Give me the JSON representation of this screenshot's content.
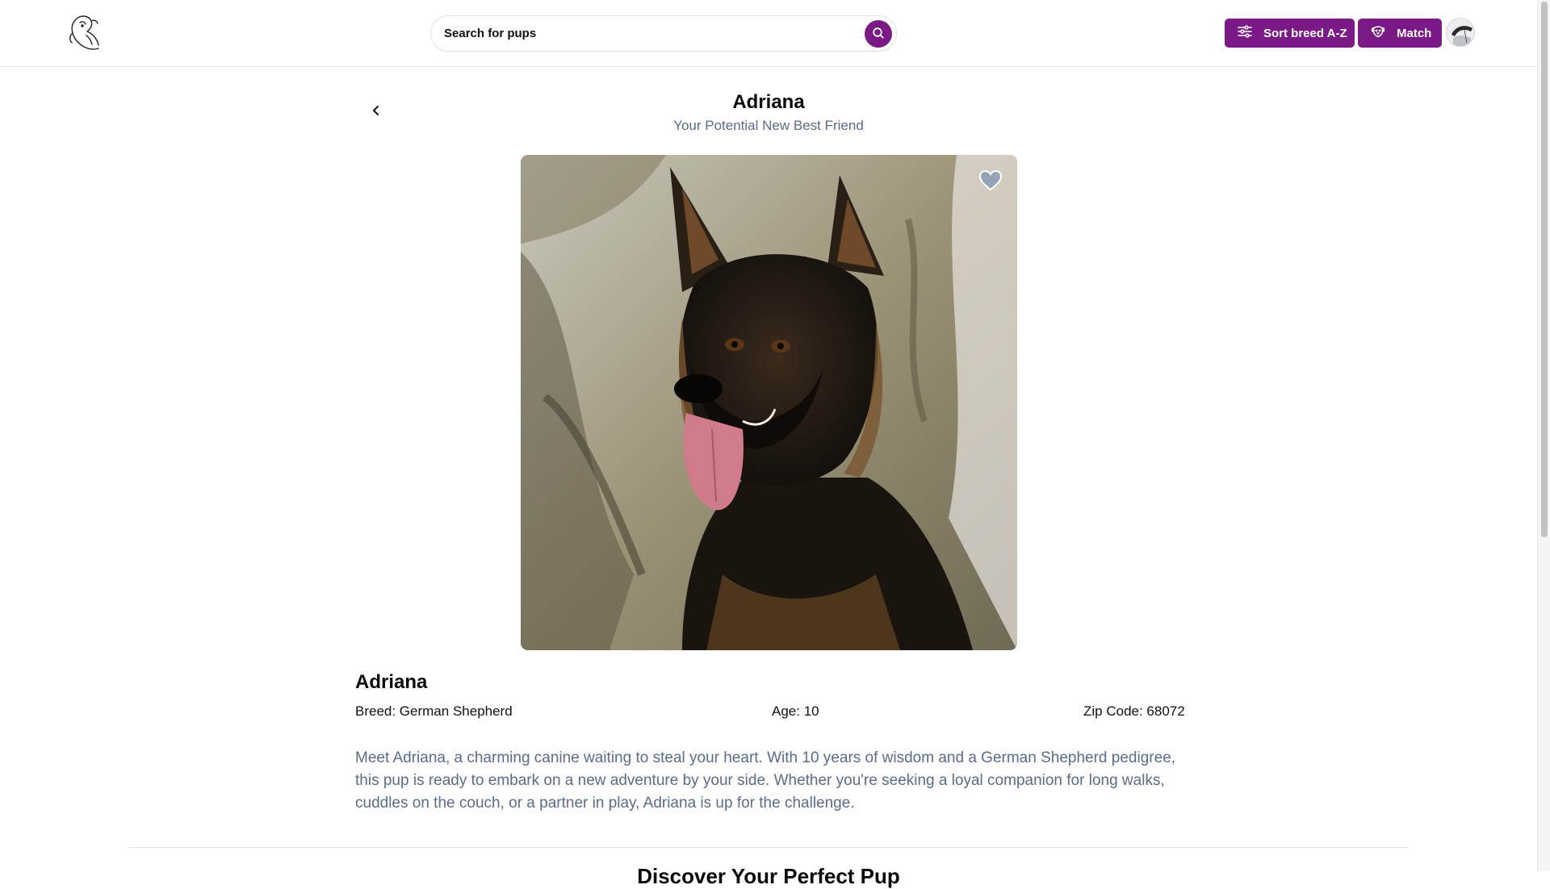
{
  "header": {
    "search": {
      "placeholder": "Search for pups",
      "value": ""
    },
    "sort_button_label": "Sort breed A-Z",
    "match_button_label": "Match",
    "accent_color": "#7b1a86"
  },
  "page": {
    "title": "Adriana",
    "subtitle": "Your Potential New Best Friend"
  },
  "dog": {
    "name": "Adriana",
    "breed": "Breed: German Shepherd",
    "age": "Age: 10",
    "zip": "Zip Code: 68072",
    "description": "Meet Adriana, a charming canine waiting to steal your heart. With 10 years of wisdom and a German Shepherd pedigree, this pup is ready to embark on a new adventure by your side. Whether you're seeking a loyal companion for long walks, cuddles on the couch, or a partner in play, Adriana is up for the challenge.",
    "favorited": false
  },
  "next_section": {
    "heading": "Discover Your Perfect Pup"
  },
  "icons": {
    "logo": "dog-logo-icon",
    "search": "search-icon",
    "sort": "sliders-icon",
    "match": "dog-face-icon",
    "back": "chevron-left-icon",
    "favorite": "heart-icon"
  }
}
